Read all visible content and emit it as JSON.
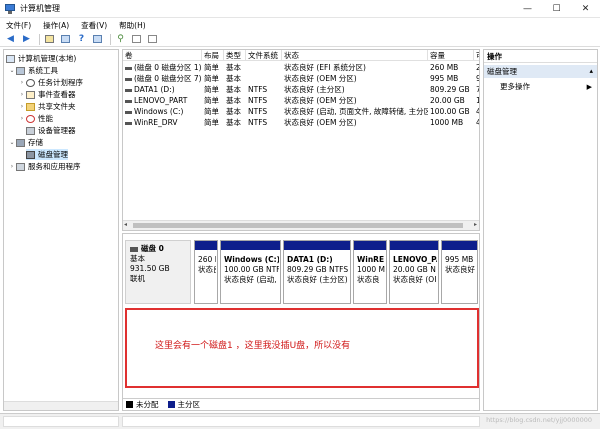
{
  "window": {
    "title": "计算机管理",
    "minimize": "—",
    "maximize": "☐",
    "close": "✕"
  },
  "menu": [
    "文件(F)",
    "操作(A)",
    "查看(V)",
    "帮助(H)"
  ],
  "tree": {
    "root": "计算机管理(本地)",
    "system_tools": "系统工具",
    "task_scheduler": "任务计划程序",
    "event_viewer": "事件查看器",
    "shared_folders": "共享文件夹",
    "performance": "性能",
    "device_manager": "设备管理器",
    "storage": "存储",
    "disk_management": "磁盘管理",
    "services": "服务和应用程序"
  },
  "volume_list": {
    "columns": [
      "卷",
      "布局",
      "类型",
      "文件系统",
      "状态",
      "容量",
      "可"
    ],
    "rows": [
      [
        "(磁盘 0 磁盘分区 1)",
        "简单",
        "基本",
        "",
        "状态良好 (EFI 系统分区)",
        "260 MB",
        "2"
      ],
      [
        "(磁盘 0 磁盘分区 7)",
        "简单",
        "基本",
        "",
        "状态良好 (OEM 分区)",
        "995 MB",
        "9"
      ],
      [
        "DATA1 (D:)",
        "简单",
        "基本",
        "NTFS",
        "状态良好 (主分区)",
        "809.29 GB",
        "7"
      ],
      [
        "LENOVO_PART",
        "简单",
        "基本",
        "NTFS",
        "状态良好 (OEM 分区)",
        "20.00 GB",
        "1"
      ],
      [
        "Windows (C:)",
        "简单",
        "基本",
        "NTFS",
        "状态良好 (启动, 页面文件, 故障转储, 主分区)",
        "100.00 GB",
        "4"
      ],
      [
        "WinRE_DRV",
        "简单",
        "基本",
        "NTFS",
        "状态良好 (OEM 分区)",
        "1000 MB",
        "4"
      ]
    ]
  },
  "disk": {
    "name": "磁盘 0",
    "type": "基本",
    "size": "931.50 GB",
    "state": "联机",
    "partitions": [
      {
        "name": "",
        "size": "260 M",
        "status": "状态良"
      },
      {
        "name": "Windows  (C:)",
        "size": "100.00 GB NTF",
        "status": "状态良好 (启动,"
      },
      {
        "name": "DATA1  (D:)",
        "size": "809.29 GB NTFS",
        "status": "状态良好 (主分区)"
      },
      {
        "name": "WinRE",
        "size": "1000 M",
        "status": "状态良"
      },
      {
        "name": "LENOVO_PA",
        "size": "20.00 GB N",
        "status": "状态良好 (OI"
      },
      {
        "name": "",
        "size": "995 MB",
        "status": "状态良好"
      }
    ]
  },
  "annotation": "这里会有一个磁盘1  ，这里我没插U盘，所以没有",
  "legend": {
    "unallocated": "未分配",
    "primary": "主分区"
  },
  "actions": {
    "header": "操作",
    "section": "磁盘管理",
    "more": "更多操作"
  },
  "watermark": "https://blog.csdn.net/yjj0000000",
  "colors": {
    "primary_partition": "#0e1f8c",
    "unallocated": "#000000",
    "annotation_border": "#e03030"
  }
}
